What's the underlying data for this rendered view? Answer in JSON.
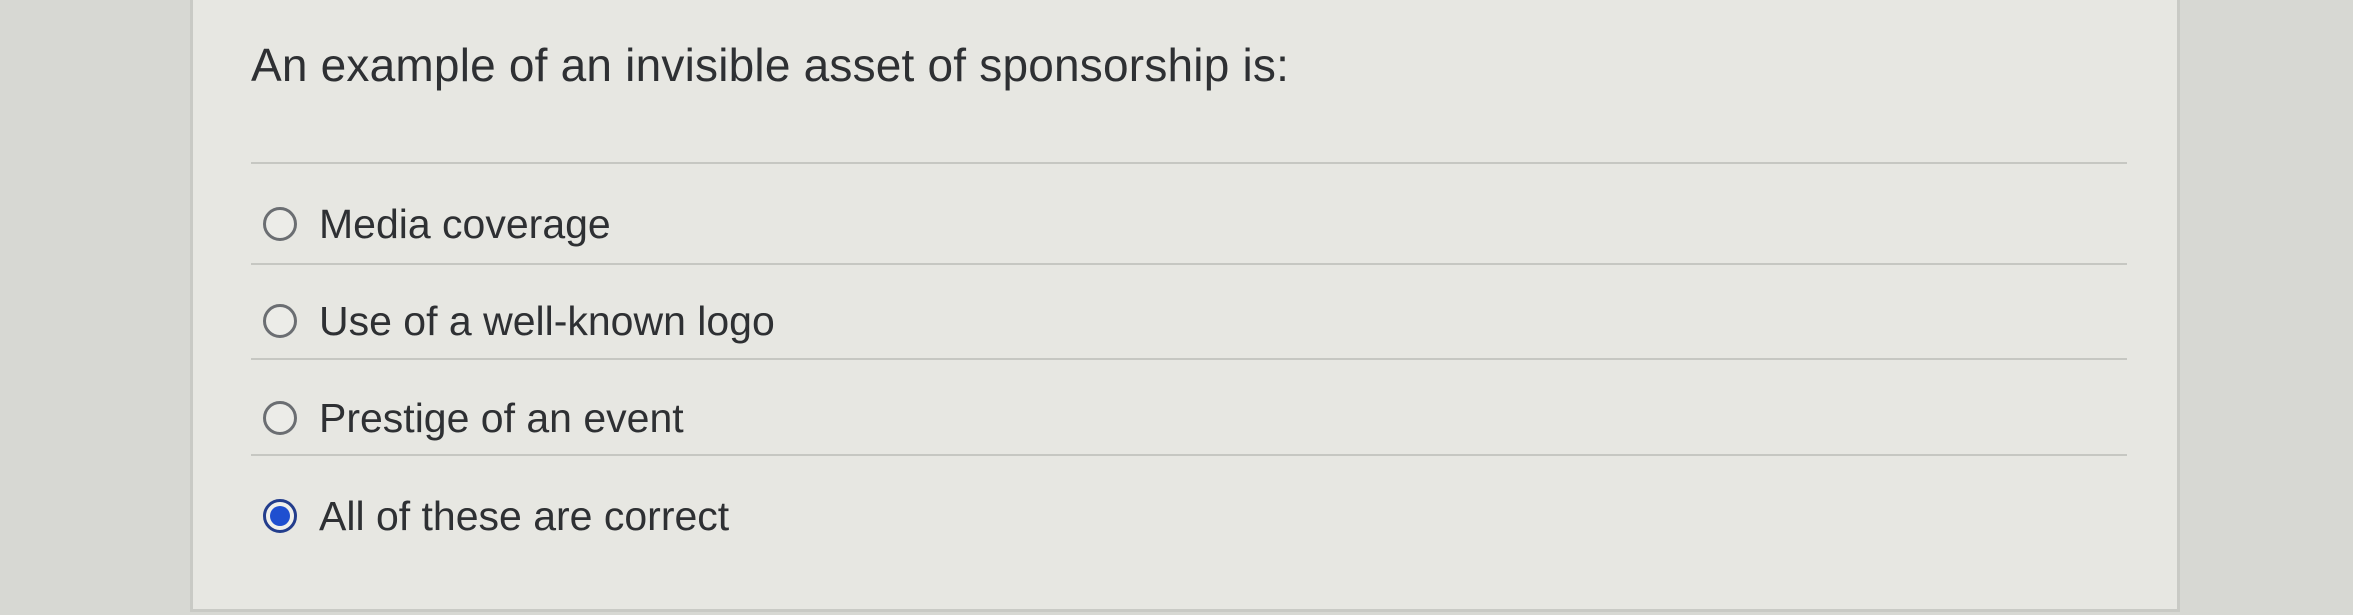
{
  "question": {
    "text": "An example of an invisible asset of sponsorship is:"
  },
  "options": [
    {
      "label": "Media coverage",
      "selected": false
    },
    {
      "label": "Use of a well-known logo",
      "selected": false
    },
    {
      "label": "Prestige of an event",
      "selected": false
    },
    {
      "label": "All of these are correct",
      "selected": true
    }
  ],
  "colors": {
    "radio_selected": "#1f4fd0",
    "text": "#2e3033"
  }
}
